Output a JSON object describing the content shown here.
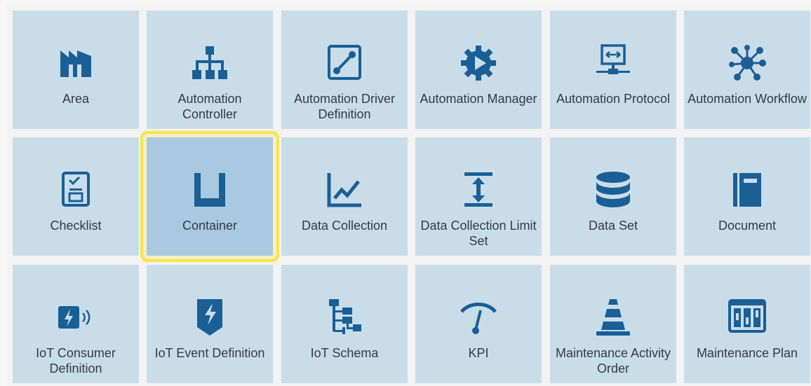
{
  "colors": {
    "tile_background": "#c9dde9",
    "tile_selected_background": "#a9c9e1",
    "selection_outline": "#f7e54a",
    "icon": "#1a5f96",
    "label": "#333b44"
  },
  "tiles": [
    {
      "label": "Area",
      "icon": "factory-icon"
    },
    {
      "label": "Automation Controller",
      "icon": "hierarchy-icon"
    },
    {
      "label": "Automation Driver Definition",
      "icon": "driver-connection-icon"
    },
    {
      "label": "Automation Manager",
      "icon": "gear-play-icon"
    },
    {
      "label": "Automation Protocol",
      "icon": "network-monitor-icon"
    },
    {
      "label": "Automation Workflow",
      "icon": "workflow-nodes-icon"
    },
    {
      "label": "Checklist",
      "icon": "checklist-icon"
    },
    {
      "label": "Container",
      "icon": "container-icon",
      "selected": true
    },
    {
      "label": "Data Collection",
      "icon": "line-chart-icon"
    },
    {
      "label": "Data Collection Limit Set",
      "icon": "limit-range-icon"
    },
    {
      "label": "Data Set",
      "icon": "database-icon"
    },
    {
      "label": "Document",
      "icon": "document-icon"
    },
    {
      "label": "IoT Consumer Definition",
      "icon": "iot-consumer-icon"
    },
    {
      "label": "IoT Event Definition",
      "icon": "iot-event-icon"
    },
    {
      "label": "IoT Schema",
      "icon": "schema-tree-icon"
    },
    {
      "label": "KPI",
      "icon": "gauge-icon"
    },
    {
      "label": "Maintenance Activity Order",
      "icon": "traffic-cone-icon"
    },
    {
      "label": "Maintenance Plan",
      "icon": "maintenance-plan-icon"
    }
  ]
}
